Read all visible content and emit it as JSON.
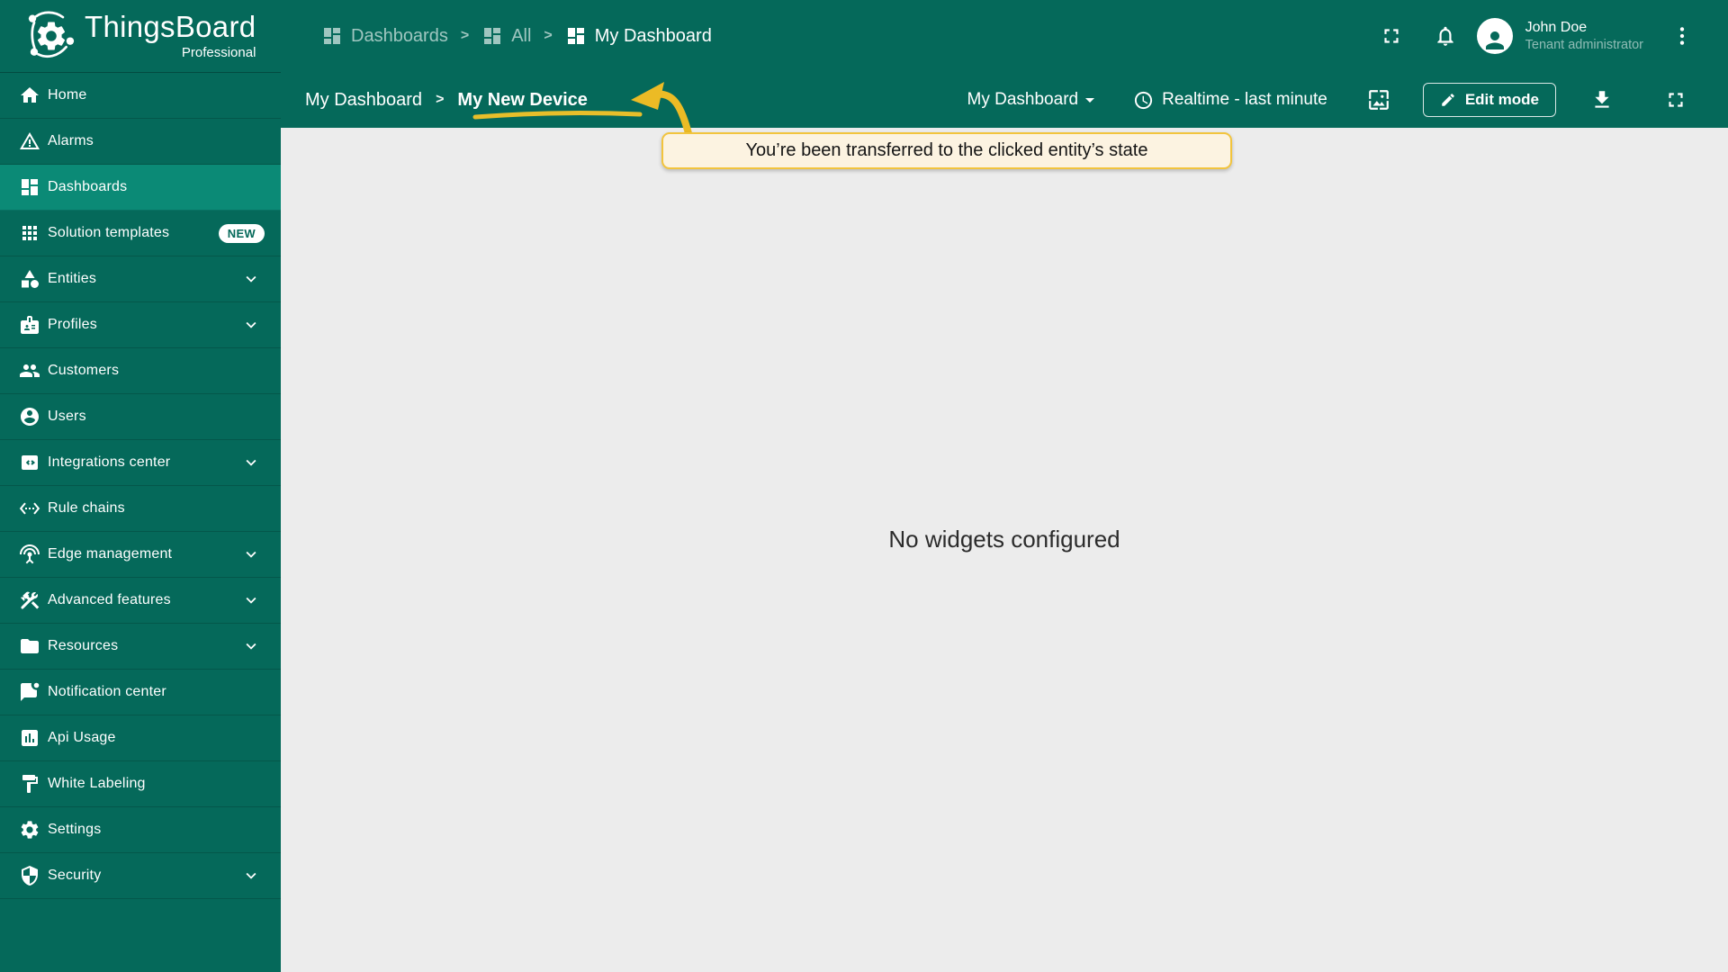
{
  "colors": {
    "primary_green": "#05695A",
    "active_green": "#0B8A76",
    "annotation_gold": "#ECBB25",
    "tooltip_bg": "#FCF3E1",
    "tooltip_border": "#F2C43D",
    "content_bg": "#ECECEC"
  },
  "header": {
    "logo": {
      "title": "ThingsBoard",
      "subtitle": "Professional",
      "icon": "thingsboard-logo"
    },
    "separator": ">",
    "breadcrumbs": [
      {
        "label": "Dashboards",
        "icon": "dashboard",
        "current": false
      },
      {
        "label": "All",
        "icon": "dashboard",
        "current": false
      },
      {
        "label": "My Dashboard",
        "icon": "dashboard",
        "current": true
      }
    ],
    "actions": {
      "fullscreen_icon": "fullscreen",
      "notifications_icon": "bell",
      "more_icon": "more-vert"
    },
    "user": {
      "name": "John Doe",
      "role": "Tenant administrator"
    }
  },
  "sidebar": {
    "items": [
      {
        "label": "Home",
        "icon": "home"
      },
      {
        "label": "Alarms",
        "icon": "alarm"
      },
      {
        "label": "Dashboards",
        "icon": "dashboard",
        "active": true
      },
      {
        "label": "Solution templates",
        "icon": "apps",
        "badge": "NEW"
      },
      {
        "label": "Entities",
        "icon": "category",
        "expandable": true
      },
      {
        "label": "Profiles",
        "icon": "badge",
        "expandable": true
      },
      {
        "label": "Customers",
        "icon": "people"
      },
      {
        "label": "Users",
        "icon": "account"
      },
      {
        "label": "Integrations center",
        "icon": "integration",
        "expandable": true
      },
      {
        "label": "Rule chains",
        "icon": "ethernet"
      },
      {
        "label": "Edge management",
        "icon": "antenna",
        "expandable": true
      },
      {
        "label": "Advanced features",
        "icon": "construction",
        "expandable": true
      },
      {
        "label": "Resources",
        "icon": "folder",
        "expandable": true
      },
      {
        "label": "Notification center",
        "icon": "chat-dot"
      },
      {
        "label": "Api Usage",
        "icon": "chart"
      },
      {
        "label": "White Labeling",
        "icon": "paint"
      },
      {
        "label": "Settings",
        "icon": "gear"
      },
      {
        "label": "Security",
        "icon": "shield",
        "expandable": true
      }
    ]
  },
  "toolbar": {
    "separator": ">",
    "state_breadcrumb": [
      {
        "label": "My Dashboard",
        "current": false
      },
      {
        "label": "My New Device",
        "current": true
      }
    ],
    "dashboard_select": "My Dashboard",
    "timewindow": "Realtime - last minute",
    "edit_button": "Edit mode"
  },
  "content": {
    "empty_message": "No widgets configured"
  },
  "annotation": {
    "tooltip": "You’re been transferred to the clicked entity’s state"
  }
}
